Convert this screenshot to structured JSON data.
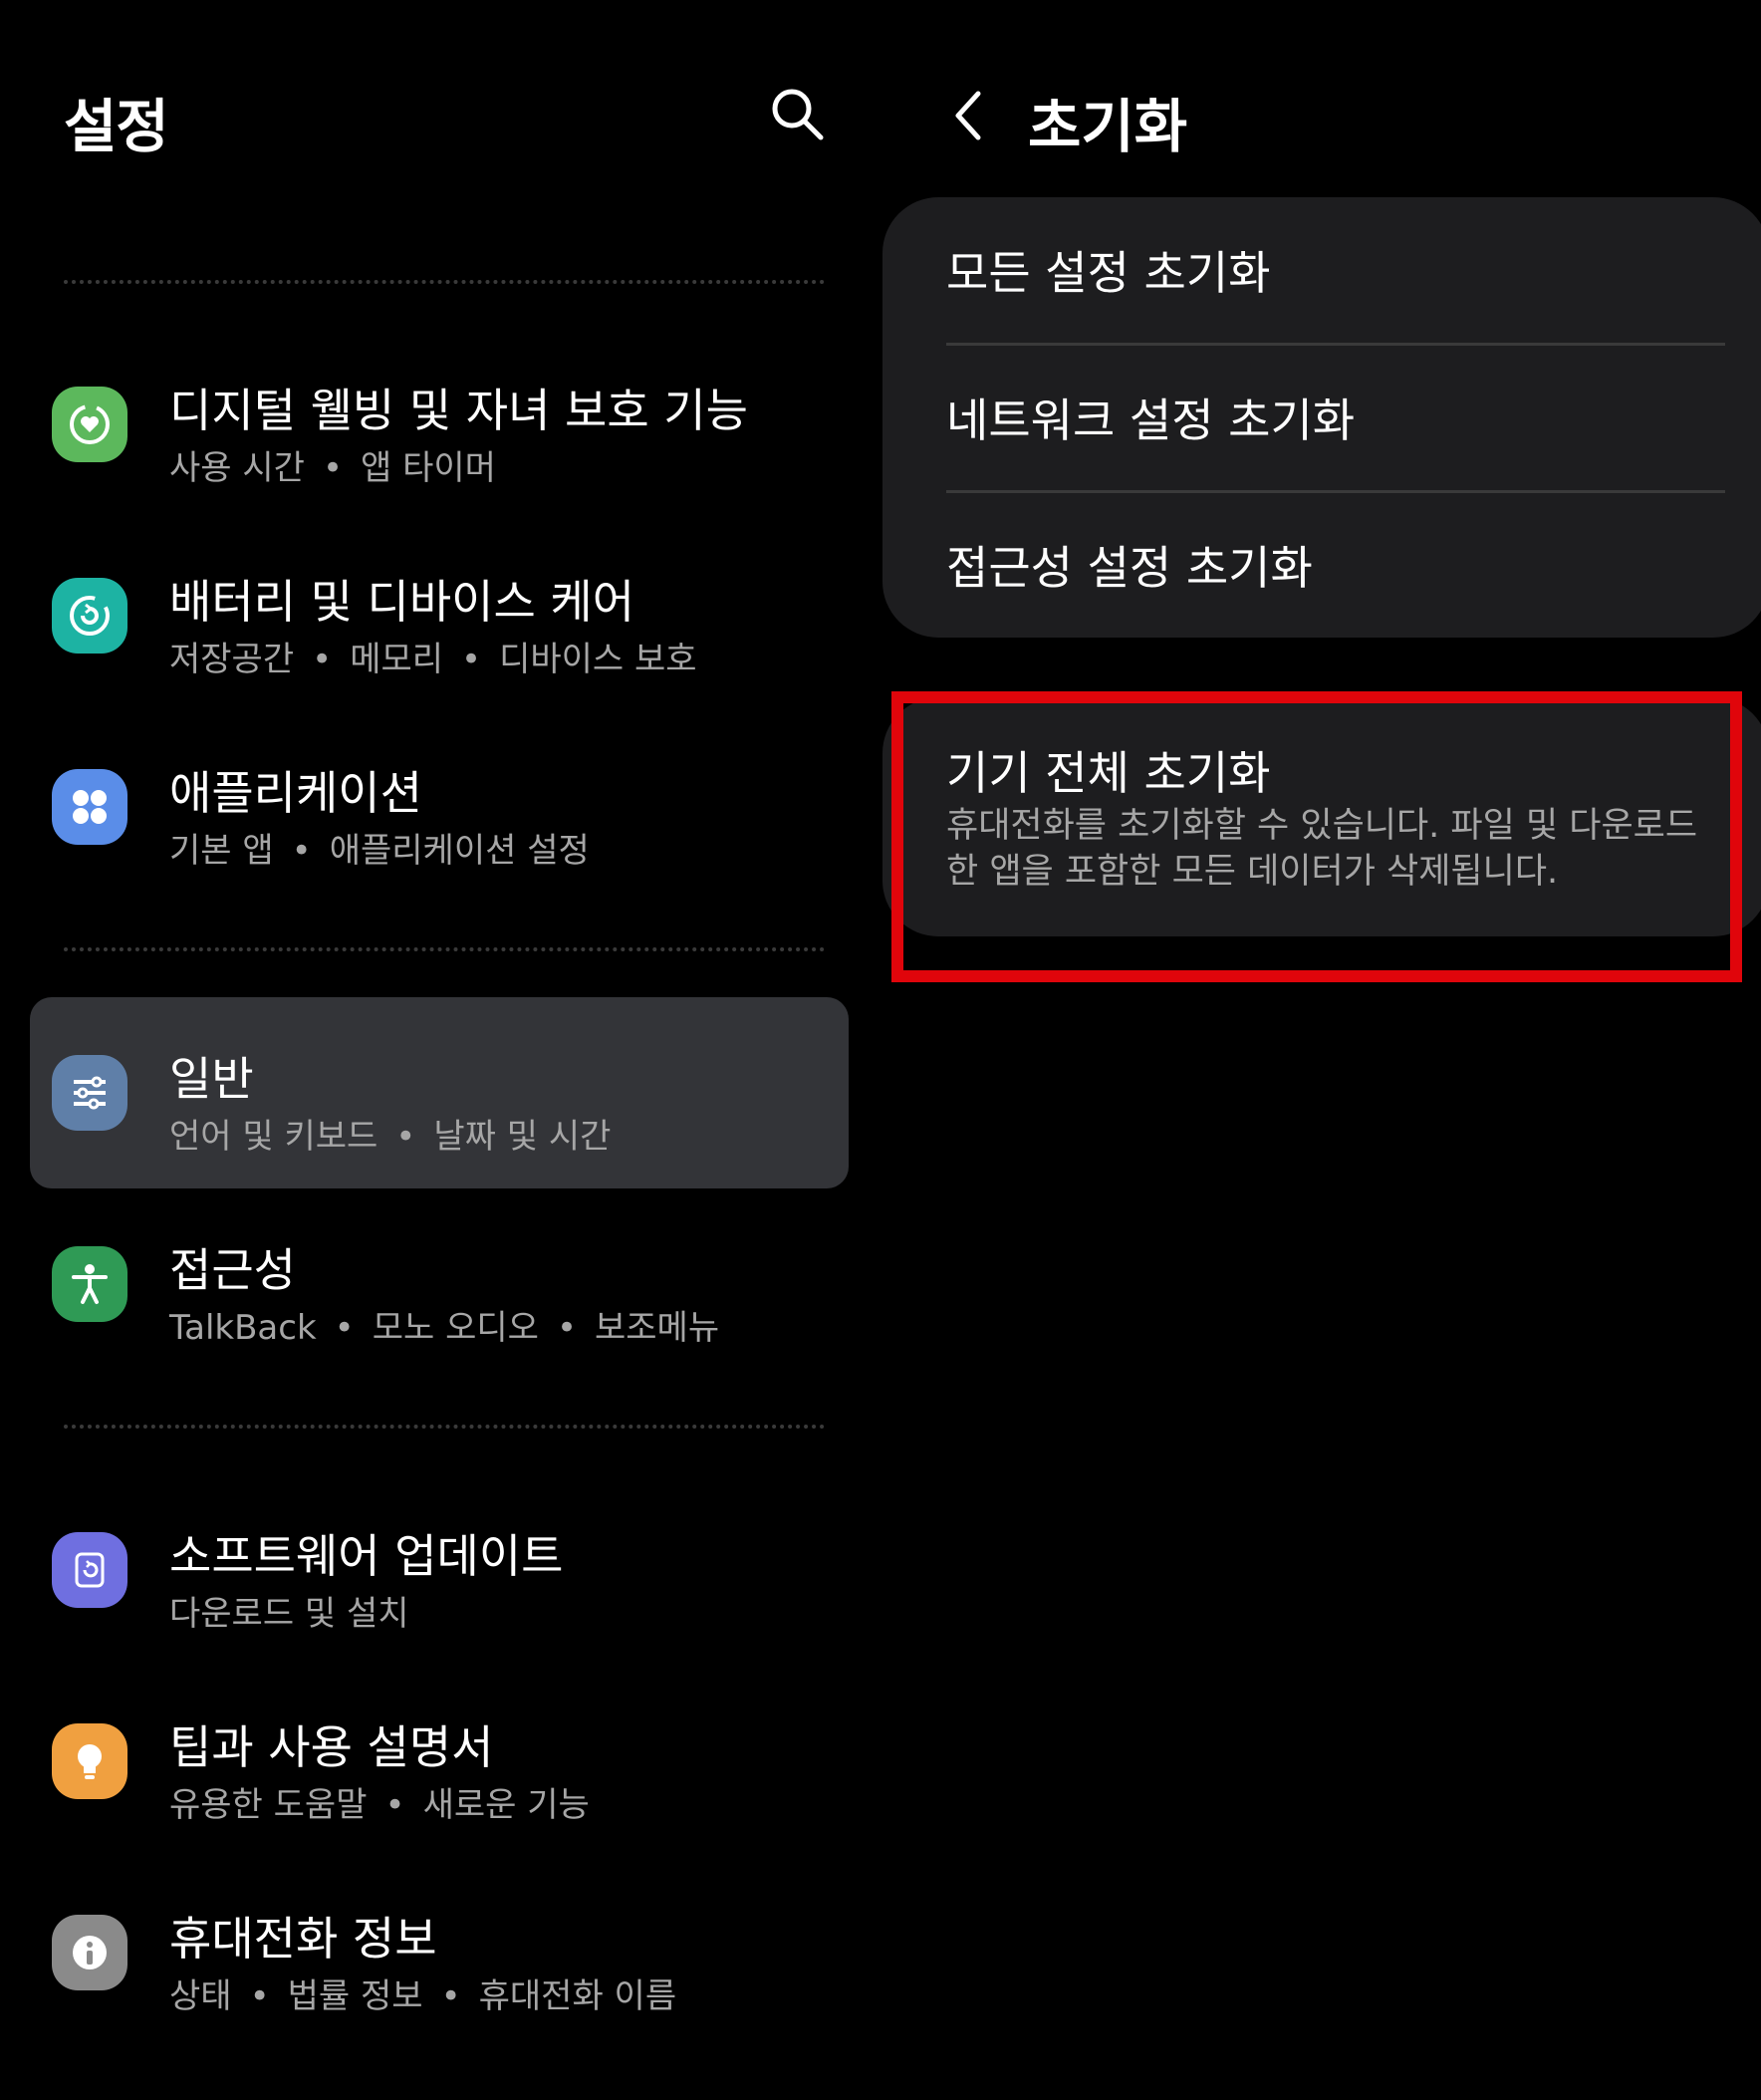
{
  "left": {
    "title": "설정",
    "items": [
      {
        "title": "디지털 웰빙 및 자녀 보호 기능",
        "sub": [
          "사용 시간",
          "앱 타이머"
        ],
        "icon": "digital-wellbeing-icon",
        "color": "#5cb85c"
      },
      {
        "title": "배터리 및 디바이스 케어",
        "sub": [
          "저장공간",
          "메모리",
          "디바이스 보호"
        ],
        "icon": "device-care-icon",
        "color": "#1db3a3"
      },
      {
        "title": "애플리케이션",
        "sub": [
          "기본 앱",
          "애플리케이션 설정"
        ],
        "icon": "apps-icon",
        "color": "#5a8de8"
      },
      {
        "title": "일반",
        "sub": [
          "언어 및 키보드",
          "날짜 및 시간"
        ],
        "icon": "general-management-icon",
        "color": "#5f7fa8",
        "selected": true
      },
      {
        "title": "접근성",
        "sub": [
          "TalkBack",
          "모노 오디오",
          "보조메뉴"
        ],
        "icon": "accessibility-icon",
        "color": "#2f9a55"
      },
      {
        "title": "소프트웨어 업데이트",
        "sub": [
          "다운로드 및 설치"
        ],
        "icon": "software-update-icon",
        "color": "#6f6fe0"
      },
      {
        "title": "팁과 사용 설명서",
        "sub": [
          "유용한 도움말",
          "새로운 기능"
        ],
        "icon": "tips-icon",
        "color": "#f0a040"
      },
      {
        "title": "휴대전화 정보",
        "sub": [
          "상태",
          "법률 정보",
          "휴대전화 이름"
        ],
        "icon": "phone-info-icon",
        "color": "#8a8a8a"
      }
    ]
  },
  "right": {
    "title": "초기화",
    "options": [
      "모든 설정 초기화",
      "네트워크 설정 초기화",
      "접근성 설정 초기화"
    ],
    "factory_reset": {
      "title": "기기 전체 초기화",
      "description": "휴대전화를 초기화할 수 있습니다. 파일 및 다운로드한 앱을 포함한 모든 데이터가 삭제됩니다."
    }
  },
  "highlight_color": "#e0050b"
}
